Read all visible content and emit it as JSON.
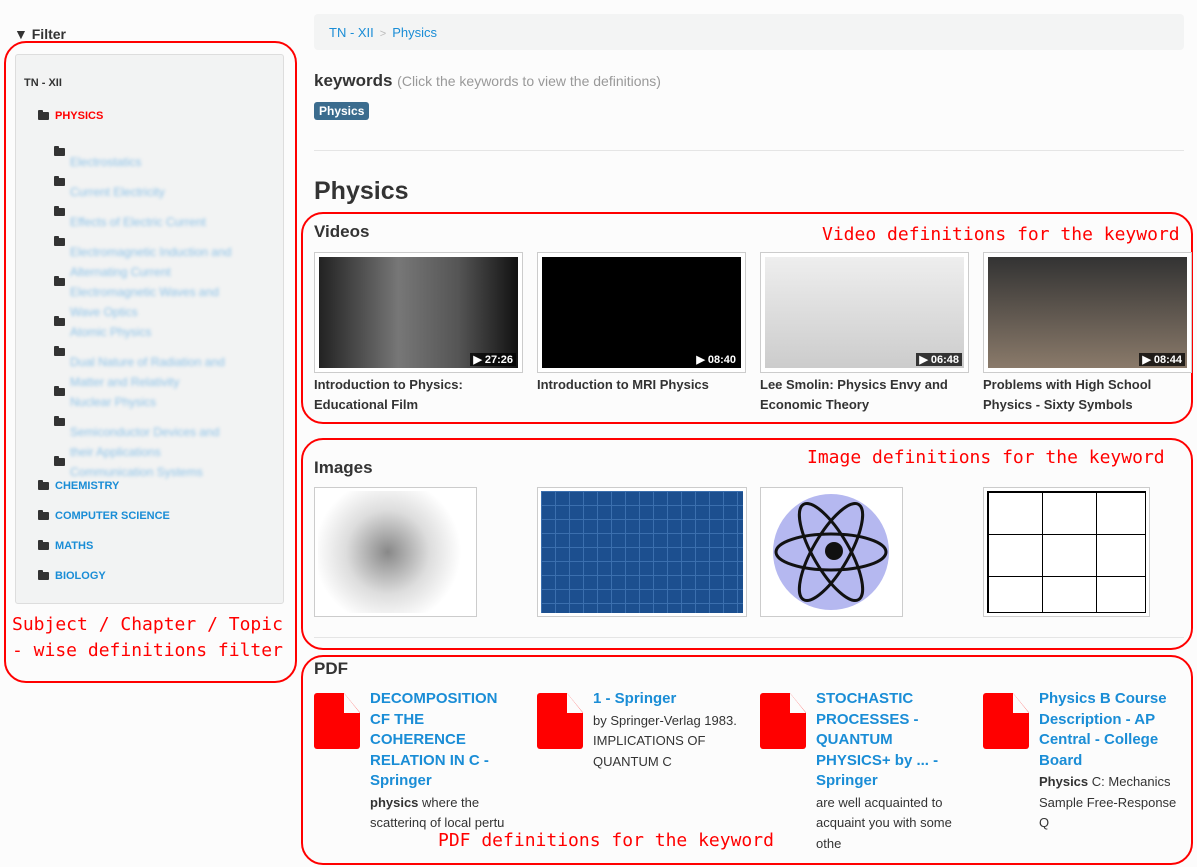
{
  "sidebar": {
    "title": "Filter",
    "root": "TN - XII",
    "active_subject": "PHYSICS",
    "topics": [
      "Electrostatics",
      "Current Electricity",
      "Effects of Electric Current",
      "Electromagnetic Induction and Alternating Current",
      "Electromagnetic Waves and Wave Optics",
      "Atomic Physics",
      "Dual Nature of Radiation and Matter and Relativity",
      "Nuclear Physics",
      "Semiconductor Devices and their Applications",
      "Communication Systems"
    ],
    "subjects": [
      "CHEMISTRY",
      "COMPUTER SCIENCE",
      "MATHS",
      "BIOLOGY"
    ]
  },
  "breadcrumb": [
    "TN - XII",
    "Physics"
  ],
  "keywords": {
    "label": "keywords",
    "hint": "(Click the keywords to view the definitions)",
    "items": [
      "Physics"
    ]
  },
  "heading": "Physics",
  "videos": {
    "title": "Videos",
    "items": [
      {
        "title": "Introduction to Physics: Educational Film",
        "duration": "27:26"
      },
      {
        "title": "Introduction to MRI Physics",
        "duration": "08:40"
      },
      {
        "title": "Lee Smolin: Physics Envy and Economic Theory",
        "duration": "06:48"
      },
      {
        "title": "Problems with High School Physics - Sixty Symbols",
        "duration": "08:44"
      }
    ]
  },
  "images": {
    "title": "Images"
  },
  "pdf": {
    "title": "PDF",
    "items": [
      {
        "title": "DECOMPOSITION CF THE COHERENCE RELATION IN C - Springer",
        "bold": "physics",
        "desc": " where the scatterinq of local pertu"
      },
      {
        "title": "1 - Springer",
        "bold": "",
        "desc": "by Springer-Verlag 1983. IMPLICATIONS OF QUANTUM C"
      },
      {
        "title": "STOCHASTIC PROCESSES - QUANTUM PHYSICS+ by ... - Springer",
        "bold": "",
        "desc": "are well acquainted to acquaint you with some othe"
      },
      {
        "title": "Physics B Course Description - AP Central - College Board",
        "bold": "Physics",
        "desc": " C: Mechanics Sample Free-Response Q"
      }
    ]
  },
  "annotations": {
    "filter": "Subject / Chapter / Topic - wise definitions filter",
    "videos": "Video definitions for the keyword",
    "images": "Image definitions for the keyword",
    "pdf": "PDF definitions for the keyword"
  },
  "colors": {
    "link": "#1a8dd6",
    "active": "#ff0000",
    "badge": "#3b6c8e",
    "annotation": "#ff0000"
  }
}
